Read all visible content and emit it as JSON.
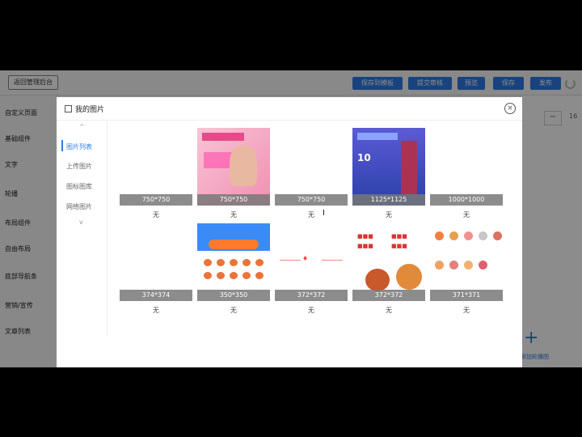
{
  "topbar": {
    "back_label": "返回管理后台",
    "buttons": [
      "保存到模板",
      "提交审核",
      "预览",
      "保存",
      "发布"
    ]
  },
  "left_nav": [
    "自定义页面",
    "基础组件",
    "文字",
    "轮播",
    "布局组件",
    "自由布局",
    "底部导航条",
    "营销/宣传",
    "文章列表"
  ],
  "right_fragment": {
    "minus": "−",
    "number": "16",
    "plus": "+",
    "add_label": "添加轮播图"
  },
  "modal": {
    "title": "我的图片",
    "close": "×",
    "tabs": [
      "图片列表",
      "上传图片",
      "图标图库",
      "网络图片"
    ],
    "active_tab": 0,
    "images": [
      {
        "size": "750*750",
        "tag": "无",
        "kind": "blank"
      },
      {
        "size": "750*750",
        "tag": "无",
        "kind": "pink"
      },
      {
        "size": "750*750",
        "tag": "无",
        "kind": "blank"
      },
      {
        "size": "1125*1125",
        "tag": "无",
        "kind": "blue"
      },
      {
        "size": "1000*1000",
        "tag": "无",
        "kind": "blank"
      },
      {
        "size": "374*374",
        "tag": "无",
        "kind": "blank"
      },
      {
        "size": "350*350",
        "tag": "无",
        "kind": "shop"
      },
      {
        "size": "372*372",
        "tag": "无",
        "kind": "line-logo"
      },
      {
        "size": "372*372",
        "tag": "无",
        "kind": "sweets"
      },
      {
        "size": "371*371",
        "tag": "无",
        "kind": "icons"
      }
    ]
  },
  "cursor_glyph": "I"
}
